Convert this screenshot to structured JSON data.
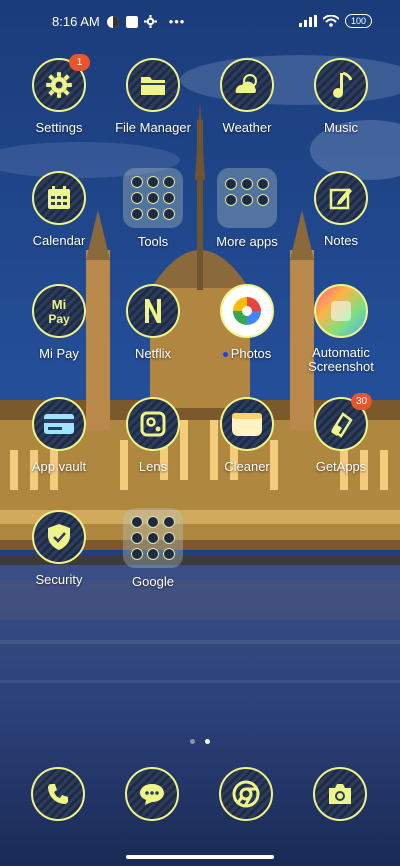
{
  "status": {
    "time": "8:16 AM",
    "battery": "100"
  },
  "apps": {
    "settings": {
      "label": "Settings",
      "badge": "1"
    },
    "file_manager": {
      "label": "File Manager"
    },
    "weather": {
      "label": "Weather"
    },
    "music": {
      "label": "Music"
    },
    "calendar": {
      "label": "Calendar"
    },
    "tools": {
      "label": "Tools"
    },
    "more_apps": {
      "label": "More apps"
    },
    "notes": {
      "label": "Notes"
    },
    "mi_pay": {
      "label": "Mi Pay"
    },
    "netflix": {
      "label": "Netflix"
    },
    "photos": {
      "label": "Photos"
    },
    "automatic_screenshot": {
      "label": "Automatic Screenshot"
    },
    "app_vault": {
      "label": "App vault"
    },
    "lens": {
      "label": "Lens"
    },
    "cleaner": {
      "label": "Cleaner"
    },
    "getapps": {
      "label": "GetApps",
      "badge": "30"
    },
    "security": {
      "label": "Security"
    },
    "google": {
      "label": "Google"
    }
  },
  "page_indicator": {
    "pages": 2,
    "active": 2
  },
  "dock": [
    "phone-icon",
    "messages-icon",
    "chrome-icon",
    "camera-icon"
  ],
  "colors": {
    "icon_accent": "#eef38a",
    "badge": "#e9542b",
    "sky": "#1f4a8f"
  }
}
